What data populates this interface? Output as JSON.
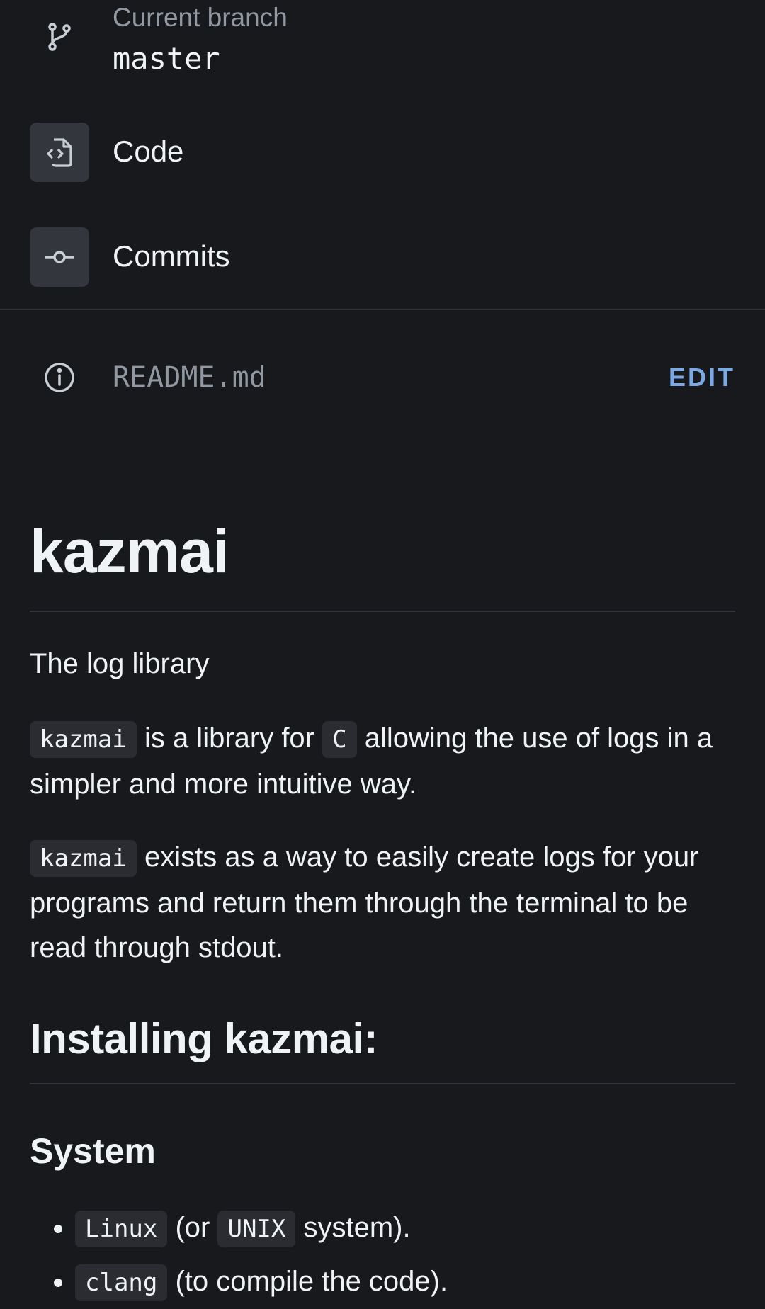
{
  "branch": {
    "caption": "Current branch",
    "name": "master"
  },
  "nav": [
    {
      "label": "Code",
      "icon": "code-file-icon"
    },
    {
      "label": "Commits",
      "icon": "commit-icon"
    }
  ],
  "readme": {
    "filename": "README.md",
    "edit_label": "EDIT"
  },
  "doc": {
    "title": "kazmai",
    "tagline": "The log library",
    "p1": {
      "code1": "kazmai",
      "t1": " is a library for ",
      "code2": "C",
      "t2": " allowing the use of logs in a simpler and more intuitive way."
    },
    "p2": {
      "code1": "kazmai",
      "t1": " exists as a way to easily create logs for your programs and return them through the terminal to be read through stdout."
    },
    "h2": "Installing kazmai:",
    "h3": "System",
    "list": [
      {
        "code1": "Linux",
        "t1": " (or ",
        "code2": "UNIX",
        "t2": " system)."
      },
      {
        "code1": "clang",
        "t1": " (to compile the code)."
      }
    ]
  }
}
